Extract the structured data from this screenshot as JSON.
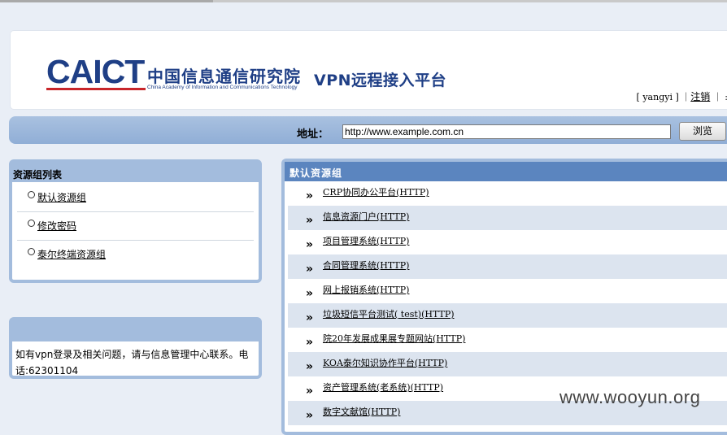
{
  "header": {
    "logo_text": "CAICT",
    "org_name_cn": "中国信息通信研究院",
    "org_name_en": "China Academy of Information and Communications Technology",
    "app_title": "VPN远程接入平台",
    "user_open": "[ ",
    "username": "yangyi",
    "user_close": " ] ｜",
    "logout": "注销",
    "trail": " ｜ :"
  },
  "address": {
    "label": "地址：",
    "value": "http://www.example.com.cn",
    "browse": "浏览"
  },
  "resource_groups": {
    "title": "资源组列表",
    "items": [
      "默认资源组",
      "修改密码",
      "泰尔终端资源组"
    ]
  },
  "help": {
    "title": "",
    "text": "如有vpn登录及相关问题，请与信息管理中心联系。电话:62301104"
  },
  "main": {
    "title": "默认资源组",
    "arrow": "»",
    "items": [
      "CRP协同办公平台(HTTP)",
      "信息资源门户(HTTP)",
      "项目管理系统(HTTP)",
      "合同管理系统(HTTP)",
      "网上报销系统(HTTP)",
      "垃圾短信平台测试( test)(HTTP)",
      "院20年发展成果展专题网站(HTTP)",
      "KOA泰尔知识协作平台(HTTP)",
      "资产管理系统(老系统)(HTTP)",
      "数字文献馆(HTTP)"
    ]
  },
  "watermark": "www.wooyun.org",
  "colors": {
    "page_bg": "#e9eef6",
    "panel_border": "#a3bcdd",
    "main_header": "#5b85bf",
    "brand_blue": "#1f3f86",
    "brand_red": "#c8262a"
  }
}
